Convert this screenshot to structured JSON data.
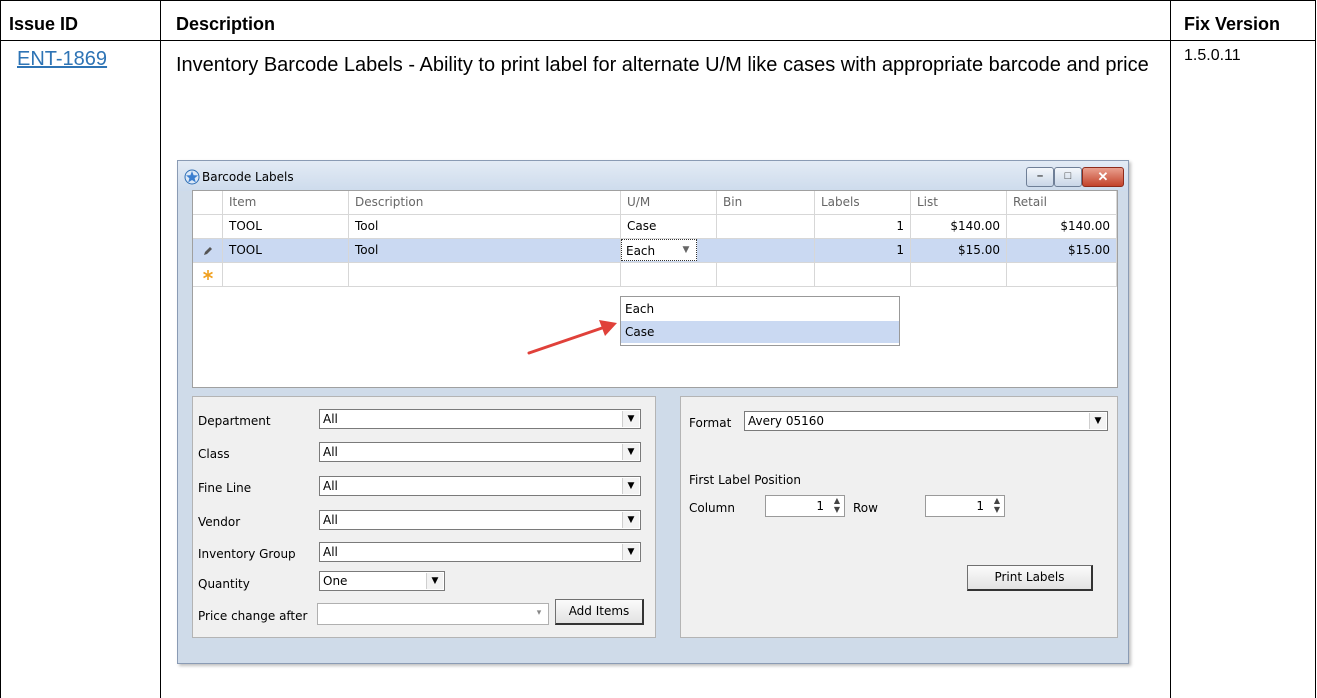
{
  "table": {
    "headers": {
      "issue_id": "Issue ID",
      "description": "Description",
      "fix_version": "Fix Version"
    },
    "row": {
      "issue_id": "ENT-1869",
      "description": "Inventory Barcode Labels - Ability to print label for alternate U/M like cases with appropriate barcode and price",
      "fix_version": "1.5.0.11"
    }
  },
  "window": {
    "title": "Barcode Labels",
    "title_icon": "star-icon",
    "controls": {
      "minimize": "–",
      "maximize": "□",
      "close": "✕"
    }
  },
  "grid": {
    "columns": [
      "Item",
      "Description",
      "U/M",
      "Bin",
      "Labels",
      "List",
      "Retail"
    ],
    "rows": [
      {
        "item": "TOOL",
        "description": "Tool",
        "um": "Case",
        "bin": "",
        "labels": "1",
        "list": "$140.00",
        "retail": "$140.00"
      },
      {
        "item": "TOOL",
        "description": "Tool",
        "um": "Each",
        "bin": "",
        "labels": "1",
        "list": "$15.00",
        "retail": "$15.00"
      }
    ],
    "row_indicators": {
      "editing": "pencil-icon",
      "new": "asterisk-icon"
    },
    "um_options": [
      "Each",
      "Case"
    ],
    "highlighted_option": "Case"
  },
  "filters": {
    "department": {
      "label": "Department",
      "value": "All"
    },
    "class": {
      "label": "Class",
      "value": "All"
    },
    "fine_line": {
      "label": "Fine Line",
      "value": "All"
    },
    "vendor": {
      "label": "Vendor",
      "value": "All"
    },
    "inventory_group": {
      "label": "Inventory Group",
      "value": "All"
    },
    "quantity": {
      "label": "Quantity",
      "value": "One"
    },
    "price_change_after": {
      "label": "Price change after",
      "value": ""
    },
    "add_items_label": "Add Items"
  },
  "format": {
    "label": "Format",
    "value": "Avery 05160",
    "first_label_position": "First Label Position",
    "column_label": "Column",
    "column_value": "1",
    "row_label": "Row",
    "row_value": "1",
    "print_label": "Print Labels"
  },
  "colors": {
    "link": "#2e74b5",
    "selection": "#cad9f2",
    "arrow": "#e0413a",
    "window_frame": "#cfdbe9"
  }
}
